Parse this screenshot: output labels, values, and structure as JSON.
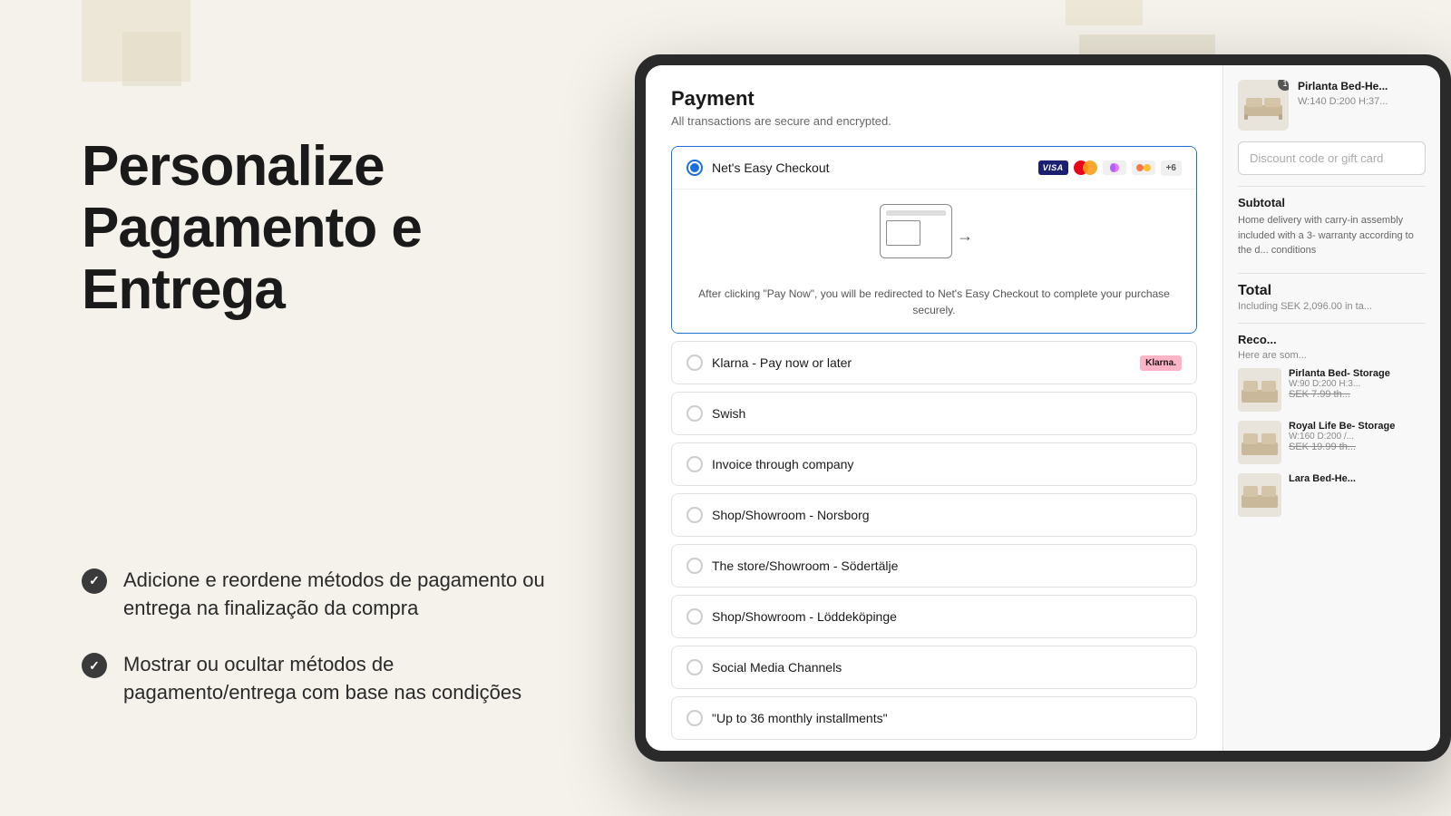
{
  "left": {
    "heading_line1": "Personalize",
    "heading_line2": "Pagamento e",
    "heading_line3": "Entrega",
    "features": [
      {
        "id": "feature1",
        "text": "Adicione e reordene métodos de pagamento ou entrega na finalização da compra"
      },
      {
        "id": "feature2",
        "text": "Mostrar ou ocultar métodos de pagamento/entrega com base nas condições"
      }
    ]
  },
  "checkout": {
    "payment": {
      "title": "Payment",
      "subtitle": "All transactions are secure and encrypted.",
      "options": [
        {
          "id": "nets",
          "label": "Net's Easy Checkout",
          "selected": true,
          "show_icons": true,
          "expanded": true,
          "redirect_text": "After clicking \"Pay Now\", you will be redirected to Net's Easy Checkout to complete your purchase securely."
        },
        {
          "id": "klarna",
          "label": "Klarna - Pay now or later",
          "selected": false
        },
        {
          "id": "swish",
          "label": "Swish",
          "selected": false
        },
        {
          "id": "invoice",
          "label": "Invoice through company",
          "selected": false
        },
        {
          "id": "norsborg",
          "label": "Shop/Showroom - Norsborg",
          "selected": false
        },
        {
          "id": "sodertalje",
          "label": "The store/Showroom - Södertälje",
          "selected": false
        },
        {
          "id": "loddeköpinge",
          "label": "Shop/Showroom - Löddeköpinge",
          "selected": false
        },
        {
          "id": "social",
          "label": "Social Media Channels",
          "selected": false
        },
        {
          "id": "installments",
          "label": "\"Up to 36 monthly installments\"",
          "selected": false
        }
      ]
    },
    "sidebar": {
      "cart_badge": "1",
      "item_name": "Pirlanta Bed-He...",
      "item_dims": "W:140 D:200 H:37...",
      "discount_placeholder": "Discount code or gift card",
      "subtotal_label": "Subtotal",
      "subtotal_description": "Home delivery with carry-in assembly included with a 3- warranty according to the d... conditions",
      "total_label": "Total",
      "total_tax": "Including SEK 2,096.00 in ta...",
      "recommendations_title": "Reco...",
      "recommendations_sub": "Here are som...",
      "reco_items": [
        {
          "name": "Pirlanta Bed- Storage",
          "dims": "W:90 D:200 H:3...",
          "price": "SEK 7.99 th..."
        },
        {
          "name": "Royal Life Be- Storage",
          "dims": "W:160 D:200 /...",
          "price": "SEK 19.99 th..."
        },
        {
          "name": "Lara Bed-He...",
          "dims": "",
          "price": ""
        }
      ]
    }
  }
}
